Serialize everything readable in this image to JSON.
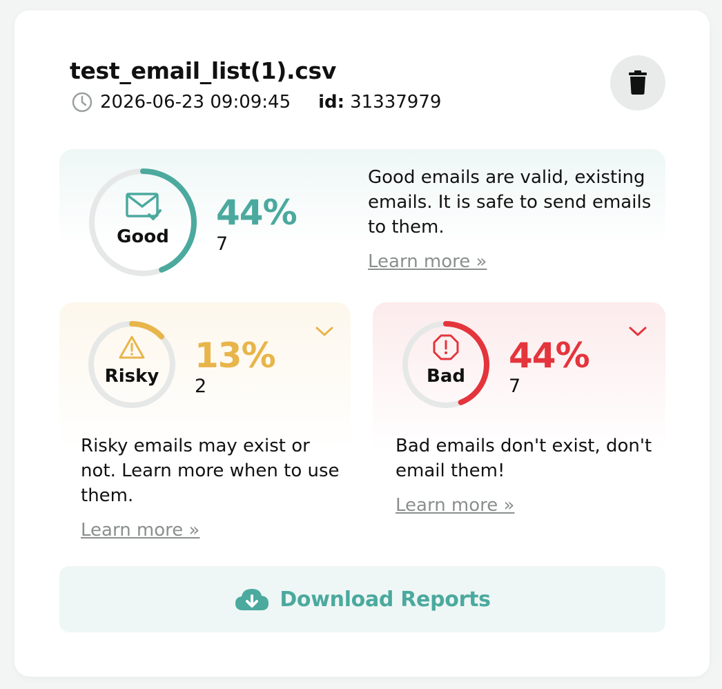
{
  "file": {
    "name": "test_email_list(1).csv",
    "datetime": "2026-06-23 09:09:45",
    "id_label": "id:",
    "id_value": "31337979"
  },
  "good": {
    "label": "Good",
    "percent_text": "44%",
    "percent": 44,
    "count": "7",
    "description_lines": [
      "Good emails are valid, existing",
      "emails. It is safe to send emails",
      "to them."
    ],
    "learn_more": "Learn more »",
    "color": "#4ba99e"
  },
  "risky": {
    "label": "Risky",
    "percent_text": "13%",
    "percent": 13,
    "count": "2",
    "description_lines": [
      "Risky emails may exist or",
      "not. Learn more when to use",
      "them."
    ],
    "learn_more": "Learn more »",
    "color": "#e8b54a"
  },
  "bad": {
    "label": "Bad",
    "percent_text": "44%",
    "percent": 44,
    "count": "7",
    "description_lines": [
      "Bad emails don't exist, don't",
      "email them!"
    ],
    "learn_more": "Learn more »",
    "color": "#e4343c"
  },
  "download": {
    "label": "Download Reports"
  },
  "icons": {
    "clock": "clock-icon",
    "trash": "trash-icon",
    "good": "mail-check-icon",
    "risky": "warning-triangle-icon",
    "bad": "alert-octagon-icon",
    "chevron": "chevron-down-icon",
    "download": "cloud-download-icon"
  }
}
